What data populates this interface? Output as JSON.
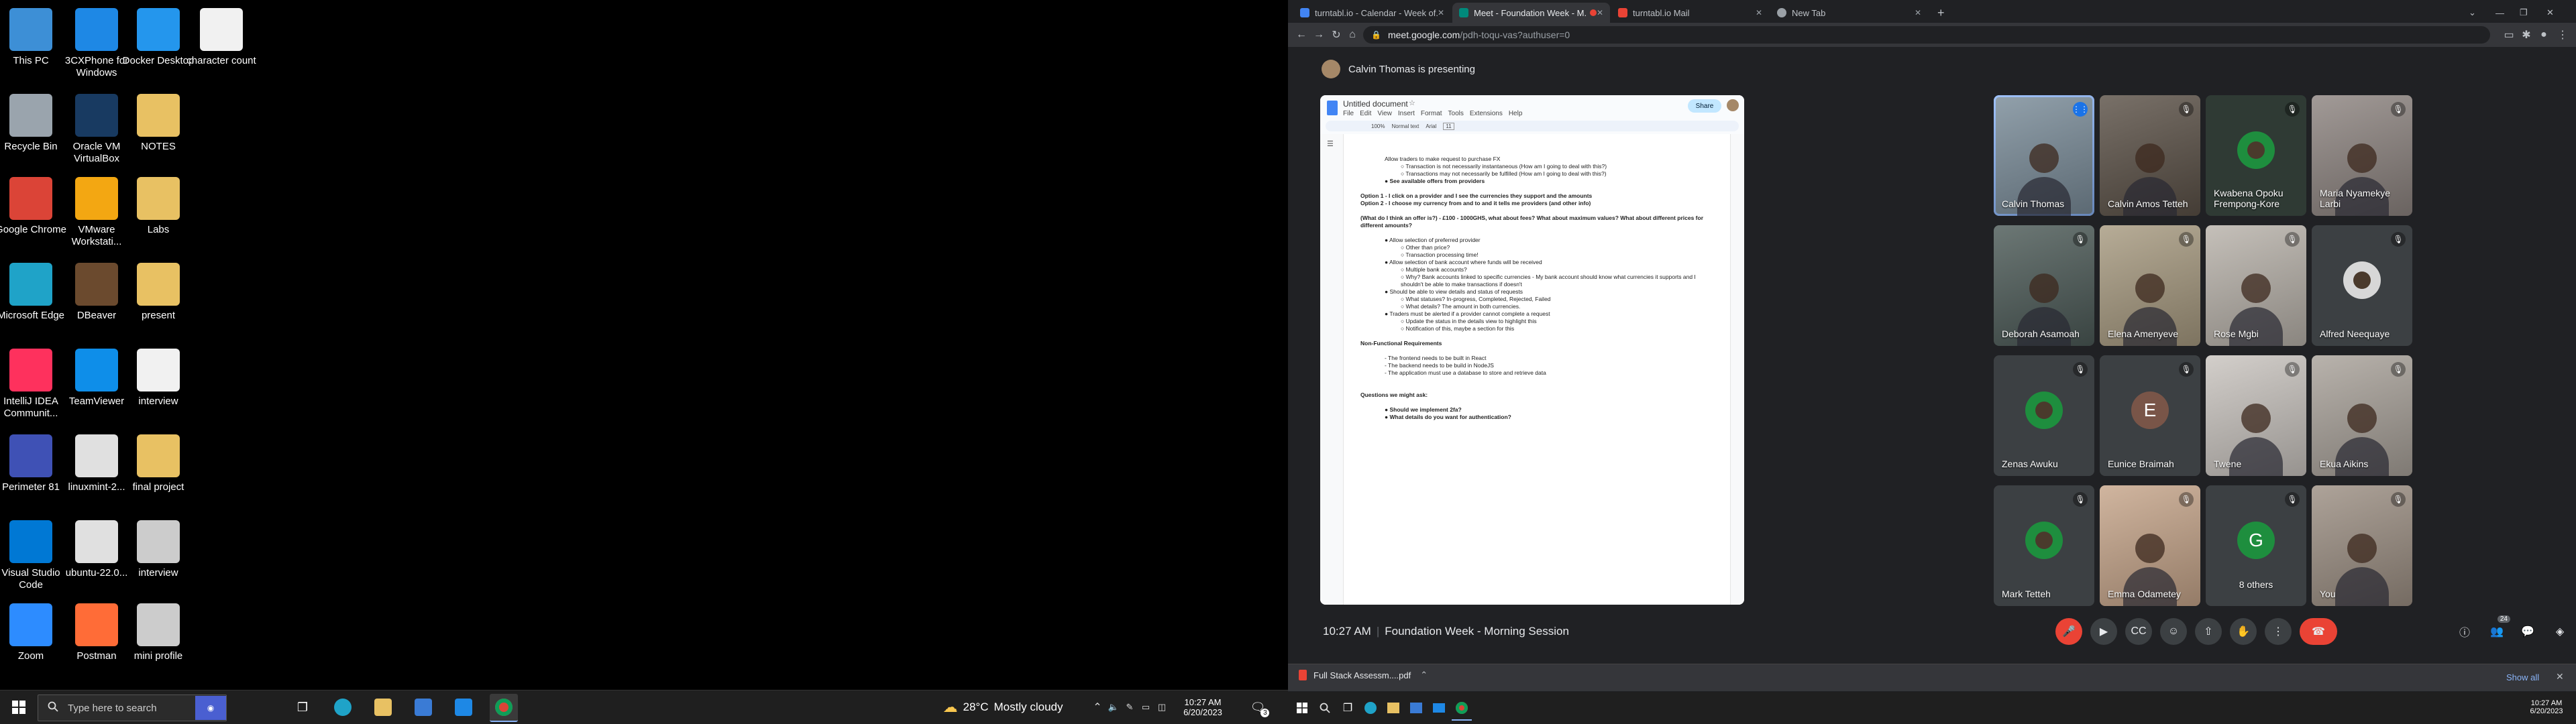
{
  "desktop": {
    "icons": [
      {
        "label": "This PC",
        "icon": "this-pc-icon",
        "color": "#3d8fd6"
      },
      {
        "label": "3CXPhone for Windows",
        "icon": "3cx-icon",
        "color": "#1e88e5"
      },
      {
        "label": "Docker Desktop",
        "icon": "docker-icon",
        "color": "#2496ed"
      },
      {
        "label": "character count",
        "icon": "text-file-icon",
        "color": "#f1f1f1"
      },
      {
        "label": "Recycle Bin",
        "icon": "recycle-bin-icon",
        "color": "#9aa4ad"
      },
      {
        "label": "Oracle VM VirtualBox",
        "icon": "virtualbox-icon",
        "color": "#183a61"
      },
      {
        "label": "NOTES",
        "icon": "folder-icon",
        "color": "#e8c163"
      },
      {
        "label": "Google Chrome",
        "icon": "chrome-icon",
        "color": "#db4437"
      },
      {
        "label": "VMware Workstati...",
        "icon": "vmware-icon",
        "color": "#f3a712"
      },
      {
        "label": "Labs",
        "icon": "folder-icon",
        "color": "#e8c163"
      },
      {
        "label": "Microsoft Edge",
        "icon": "edge-icon",
        "color": "#1fa3c8"
      },
      {
        "label": "DBeaver",
        "icon": "dbeaver-icon",
        "color": "#6b4a2e"
      },
      {
        "label": "present",
        "icon": "folder-icon",
        "color": "#e8c163"
      },
      {
        "label": "IntelliJ IDEA Communit...",
        "icon": "intellij-icon",
        "color": "#fe315d"
      },
      {
        "label": "TeamViewer",
        "icon": "teamviewer-icon",
        "color": "#0e8ee9"
      },
      {
        "label": "interview",
        "icon": "text-file-icon",
        "color": "#f1f1f1"
      },
      {
        "label": "Perimeter 81",
        "icon": "perimeter81-icon",
        "color": "#3f51b5"
      },
      {
        "label": "linuxmint-2...",
        "icon": "disc-image-icon",
        "color": "#e0e0e0"
      },
      {
        "label": "final project",
        "icon": "folder-icon",
        "color": "#e8c163"
      },
      {
        "label": "Visual Studio Code",
        "icon": "vscode-icon",
        "color": "#0078d4"
      },
      {
        "label": "ubuntu-22.0...",
        "icon": "disc-image-icon",
        "color": "#e0e0e0"
      },
      {
        "label": "interview",
        "icon": "shortcut-icon",
        "color": "#cccccc"
      },
      {
        "label": "Zoom",
        "icon": "zoom-icon",
        "color": "#2d8cff"
      },
      {
        "label": "Postman",
        "icon": "postman-icon",
        "color": "#ff6c37"
      },
      {
        "label": "mini profile",
        "icon": "shortcut-icon",
        "color": "#cccccc"
      }
    ]
  },
  "left_taskbar": {
    "search_placeholder": "Type here to search",
    "weather_temp": "28°C",
    "weather_text": "Mostly cloudy",
    "time": "10:27 AM",
    "date": "6/20/2023",
    "notifications": "3"
  },
  "chrome": {
    "tabs": [
      {
        "title": "turntabl.io - Calendar - Week of...",
        "color": "#4285f4"
      },
      {
        "title": "Meet - Foundation Week - M...",
        "color": "#00897b"
      },
      {
        "title": "turntabl.io Mail",
        "color": "#ea4335"
      },
      {
        "title": "New Tab",
        "color": "#9aa0a6"
      }
    ],
    "url": "meet.google.com",
    "url_path": "/pdh-toqu-vas?authuser=0"
  },
  "meet": {
    "presenting_banner": "Calvin Thomas is presenting",
    "doc_title": "Untitled document",
    "doc_menu": [
      "File",
      "Edit",
      "View",
      "Insert",
      "Format",
      "Tools",
      "Extensions",
      "Help"
    ],
    "share_label": "Share",
    "doc_zoom": "100%",
    "doc_style": "Normal text",
    "doc_font": "Arial",
    "doc_size": "11",
    "doc_lines": [
      {
        "t": "Allow traders to make request to purchase FX",
        "cls": "ind1"
      },
      {
        "t": "○ Transaction is not necessarily instantaneous (How am I going to deal with this?)",
        "cls": "ind2"
      },
      {
        "t": "○ Transactions may not necessarily be fulfilled (How am I going to deal with this?)",
        "cls": "ind2"
      },
      {
        "t": "● See available offers from providers",
        "cls": "ind1 b"
      },
      {
        "t": "",
        "cls": ""
      },
      {
        "t": "Option 1 - I click on a provider and I see the currencies they support and the amounts",
        "cls": "b"
      },
      {
        "t": "Option 2 - I choose my currency from and to and it tells me providers (and other info)",
        "cls": "b"
      },
      {
        "t": "",
        "cls": ""
      },
      {
        "t": "(What do I think an offer is?) - £100 - 1000GHS, what about fees? What about maximum values? What about different prices for different amounts?",
        "cls": "b"
      },
      {
        "t": "",
        "cls": ""
      },
      {
        "t": "● Allow selection of preferred provider",
        "cls": "ind1"
      },
      {
        "t": "○ Other than price?",
        "cls": "ind2"
      },
      {
        "t": "○ Transaction processing time!",
        "cls": "ind2"
      },
      {
        "t": "● Allow selection of bank account where funds will be received",
        "cls": "ind1"
      },
      {
        "t": "○ Multiple bank accounts?",
        "cls": "ind2"
      },
      {
        "t": "○ Why? Bank accounts linked to specific currencies - My bank account should know what currencies it supports and I shouldn't be able to make transactions if doesn't",
        "cls": "ind2"
      },
      {
        "t": "● Should be able to view details and status of requests",
        "cls": "ind1"
      },
      {
        "t": "○ What statuses? In-progress, Completed, Rejected, Failed",
        "cls": "ind2"
      },
      {
        "t": "○ What details? The amount in both currencies.",
        "cls": "ind2"
      },
      {
        "t": "● Traders must be alerted if a provider cannot complete a request",
        "cls": "ind1"
      },
      {
        "t": "○ Update the status in the details view to highlight this",
        "cls": "ind2"
      },
      {
        "t": "○ Notification of this, maybe a section for this",
        "cls": "ind2"
      },
      {
        "t": "",
        "cls": ""
      },
      {
        "t": "Non-Functional Requirements",
        "cls": "b"
      },
      {
        "t": "",
        "cls": ""
      },
      {
        "t": "- The frontend needs to be built in React",
        "cls": "ind1"
      },
      {
        "t": "- The backend needs to be build in NodeJS",
        "cls": "ind1"
      },
      {
        "t": "- The application must use a database to store and retrieve data",
        "cls": "ind1"
      },
      {
        "t": "",
        "cls": ""
      },
      {
        "t": "",
        "cls": ""
      },
      {
        "t": "Questions we might ask:",
        "cls": "b"
      },
      {
        "t": "",
        "cls": ""
      },
      {
        "t": "● Should we implement 2fa?",
        "cls": "ind1 b"
      },
      {
        "t": "● What details do you want for authentication?",
        "cls": "ind1 b"
      }
    ],
    "participants": [
      {
        "name": "Calvin Thomas",
        "type": "video",
        "bg": "#7a8c99",
        "speaking": true
      },
      {
        "name": "Calvin Amos Tetteh",
        "type": "video",
        "bg": "#5b5147"
      },
      {
        "name": "Kwabena Opoku Frempong-Kore",
        "type": "avatar",
        "bg": "#2f3a34",
        "avatar_bg": "#1e8e3e",
        "avatar_text": ""
      },
      {
        "name": "Maria Nyamekye Larbi",
        "type": "video",
        "bg": "#8d8480"
      },
      {
        "name": "Deborah Asamoah",
        "type": "video",
        "bg": "#4c5a57"
      },
      {
        "name": "Elena Amenyeve",
        "type": "video",
        "bg": "#a79a80"
      },
      {
        "name": "Rose Mgbi",
        "type": "video",
        "bg": "#b8b2aa"
      },
      {
        "name": "Alfred Neequaye",
        "type": "avatar",
        "bg": "#3c4043",
        "avatar_bg": "#d7d7d7",
        "avatar_text": ""
      },
      {
        "name": "Zenas Awuku",
        "type": "avatar",
        "bg": "#3c4043",
        "avatar_bg": "#1e8e3e",
        "avatar_text": ""
      },
      {
        "name": "Eunice Braimah",
        "type": "letter",
        "bg": "#3c4043",
        "avatar_bg": "#795548",
        "avatar_text": "E"
      },
      {
        "name": "Twene",
        "type": "video",
        "bg": "#c9c4bf"
      },
      {
        "name": "Ekua Aikins",
        "type": "video",
        "bg": "#a9a29a"
      },
      {
        "name": "Mark Tetteh",
        "type": "avatar",
        "bg": "#3c4043",
        "avatar_bg": "#1e8e3e",
        "avatar_text": ""
      },
      {
        "name": "Emma Odametey",
        "type": "video",
        "bg": "#c6a58a"
      },
      {
        "name": "8 others",
        "type": "others",
        "bg": "#3c4043",
        "avatar_bg": "#1e8e3e",
        "avatar_text": "G"
      },
      {
        "name": "You",
        "type": "video",
        "bg": "#9c8f83"
      }
    ],
    "bottom_time": "10:27 AM",
    "separator": "|",
    "meeting_title": "Foundation Week - Morning Session",
    "people_count": "24"
  },
  "download": {
    "file": "Full Stack Assessm....pdf",
    "show_all": "Show all"
  },
  "right_taskbar": {
    "time": "10:27 AM",
    "date": "6/20/2023"
  }
}
